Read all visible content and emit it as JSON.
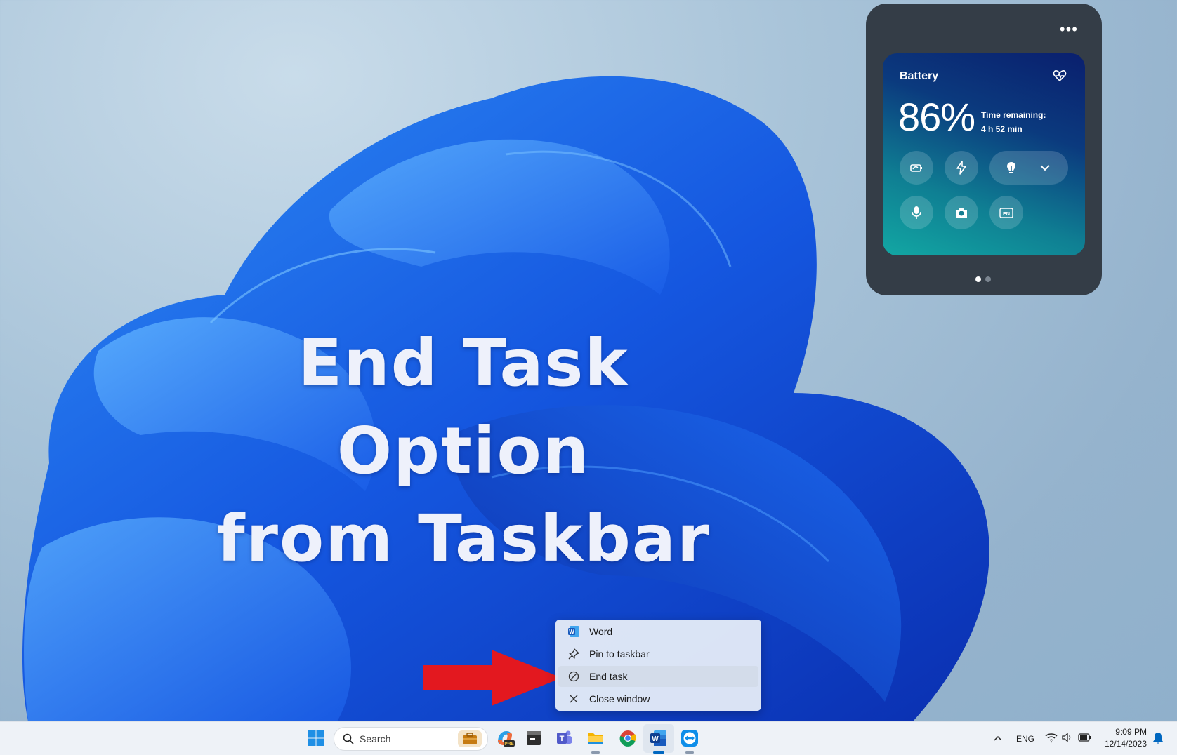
{
  "headline": {
    "line1": "End Task Option",
    "line2": "from Taskbar"
  },
  "battery_widget": {
    "more_label": "•••",
    "title": "Battery",
    "percent": "86%",
    "time_remaining_label": "Time remaining:",
    "time_remaining_value": "4 h 52 min",
    "buttons": [
      "battery-saver-icon",
      "power-mode-icon",
      "lightbulb-icon",
      "chevron-down-icon",
      "microphone-icon",
      "camera-icon",
      "fn-key-icon"
    ],
    "fn_label": "FN",
    "page_dots": 2,
    "active_dot": 1
  },
  "context_menu": {
    "items": [
      {
        "label": "Word",
        "icon": "word-icon"
      },
      {
        "label": "Pin to taskbar",
        "icon": "pin-icon"
      },
      {
        "label": "End task",
        "icon": "end-task-icon"
      },
      {
        "label": "Close window",
        "icon": "close-icon"
      }
    ]
  },
  "taskbar": {
    "search_placeholder": "Search",
    "apps": [
      "start-icon",
      "search-icon",
      "briefcase-icon",
      "copilot-pre-icon",
      "terminal-icon",
      "teams-icon",
      "file-explorer-icon",
      "chrome-icon",
      "word-icon",
      "teamviewer-icon"
    ],
    "tray": {
      "language": "ENG",
      "time": "9:09 PM",
      "date": "12/14/2023"
    }
  },
  "colors": {
    "arrow": "#e3181f",
    "widget_bg": "#343d47",
    "accent": "#0067c0"
  }
}
